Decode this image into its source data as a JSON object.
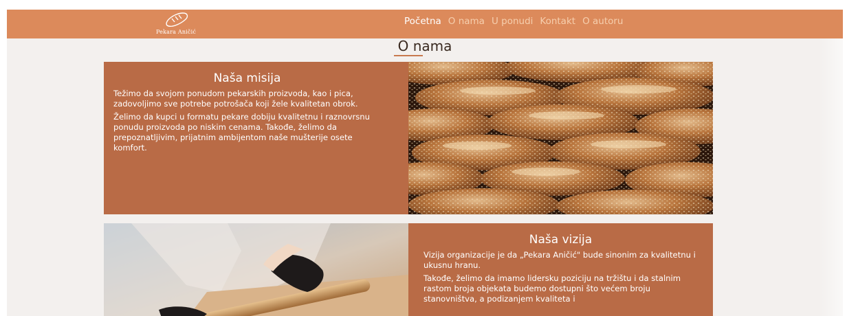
{
  "brand": {
    "name": "Pekara Aničić"
  },
  "nav": {
    "items": [
      {
        "label": "Početna"
      },
      {
        "label": "O nama"
      },
      {
        "label": "U ponudi"
      },
      {
        "label": "Kontakt"
      },
      {
        "label": "O autoru"
      }
    ]
  },
  "section": {
    "title": "O nama"
  },
  "mission": {
    "heading": "Naša misija",
    "p1": "Težimo da svojom ponudom pekarskih proizvoda, kao i pica, zadovoljimo sve potrebe potrošača koji žele kvalitetan obrok.",
    "p2": "Želimo da kupci u formatu pekare dobiju kvalitetnu i raznovrsnu ponudu proizvoda po niskim cenama. Takođe, želimo da prepoznatljivim, prijatnim ambijentom naše mušterije osete komfort."
  },
  "vision": {
    "heading": "Naša vizija",
    "p1": "Vizija organizacije je da „Pekara Aničić\" bude sinonim za kvalitetnu i ukusnu hranu.",
    "p2": "Takođe, želimo da imamo lidersku poziciju na tržištu i da stalnim rastom broja objekata budemo dostupni što većem broju stanovništva, a podizanjem kvaliteta i"
  },
  "colors": {
    "navbar": "#dc8a5b",
    "card": "#b96b46",
    "background": "#f3f0ee"
  }
}
